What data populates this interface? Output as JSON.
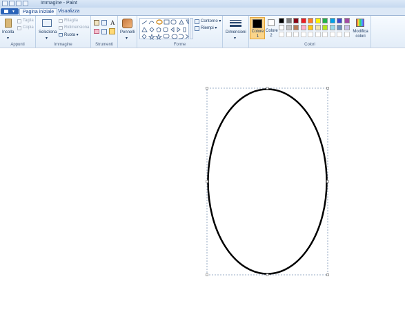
{
  "window": {
    "title": "Immagine - Paint"
  },
  "tabs": [
    {
      "label": "Pagina iniziale",
      "active": true
    },
    {
      "label": "Visualizza",
      "active": false
    }
  ],
  "groups": {
    "appunti": {
      "label": "Appunti",
      "paste": "Incolla",
      "cut": "Taglia",
      "copy": "Copia"
    },
    "immagine": {
      "label": "Immagine",
      "select": "Seleziona",
      "crop": "Ritaglia",
      "resize": "Ridimensiona",
      "rotate": "Ruota"
    },
    "strumenti": {
      "label": "Strumenti"
    },
    "pennelli": {
      "label": "Pennelli"
    },
    "forme": {
      "label": "Forme",
      "outline": "Contorno",
      "fill": "Riempi"
    },
    "dimensioni": {
      "label": "Dimensioni"
    },
    "colori": {
      "label": "Colori",
      "color1": "Colore 1",
      "color2": "Colore 2",
      "edit": "Modifica colori"
    }
  },
  "palette": {
    "color1": "#000000",
    "color2": "#ffffff",
    "row1": [
      "#000000",
      "#7f7f7f",
      "#880015",
      "#ed1c24",
      "#ff7f27",
      "#fff200",
      "#22b14c",
      "#00a2e8",
      "#3f48cc",
      "#a349a4"
    ],
    "row2": [
      "#ffffff",
      "#c3c3c3",
      "#b97a57",
      "#ffaec9",
      "#ffc90e",
      "#efe4b0",
      "#b5e61d",
      "#99d9ea",
      "#7092be",
      "#c8bfe7"
    ],
    "row3": [
      "#ffffff",
      "#ffffff",
      "#ffffff",
      "#ffffff",
      "#ffffff",
      "#ffffff",
      "#ffffff",
      "#ffffff",
      "#ffffff",
      "#ffffff"
    ]
  },
  "canvas": {
    "shape": "ellipse",
    "stroke_color": "#000000",
    "selected": true
  }
}
